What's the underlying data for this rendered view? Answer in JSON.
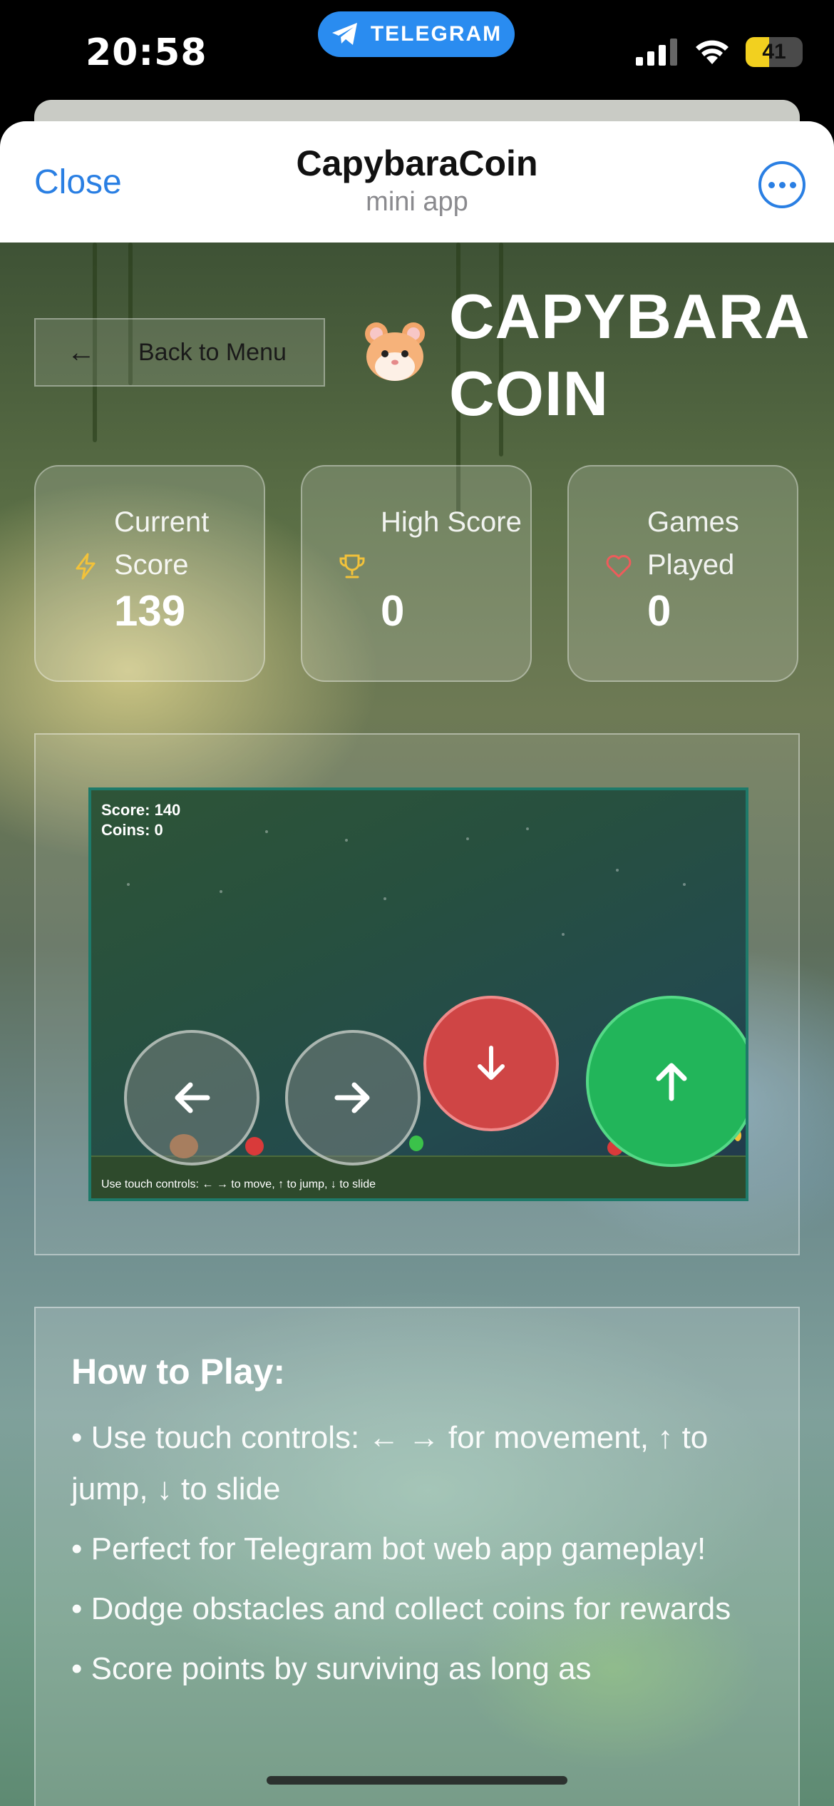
{
  "status_bar": {
    "time": "20:58",
    "pill_label": "TELEGRAM",
    "battery": "41",
    "battery_level": 0.41
  },
  "header": {
    "close_label": "Close",
    "title": "CapybaraCoin",
    "subtitle": "mini app"
  },
  "game_page": {
    "back_label": "Back to Menu",
    "brand_line1": "CAPYBARA",
    "brand_line2": "COIN",
    "stats": [
      {
        "label": "Current Score",
        "value": "139",
        "icon": "lightning-icon"
      },
      {
        "label": "High Score",
        "value": "0",
        "icon": "trophy-icon"
      },
      {
        "label": "Games Played",
        "value": "0",
        "icon": "heart-icon"
      }
    ],
    "canvas": {
      "score_text": "Score: 140",
      "coins_text": "Coins: 0",
      "hint": "Use touch controls: ← → to move, ↑ to jump, ↓ to slide"
    },
    "controls": {
      "left": "←",
      "right": "→",
      "down": "↓",
      "up": "↑"
    },
    "howto": {
      "title": "How to Play:",
      "items": [
        "• Use touch controls: ← → for movement, ↑ to jump, ↓ to slide",
        "• Perfect for Telegram bot web app gameplay!",
        "• Dodge obstacles and collect coins for rewards",
        "• Score points by surviving as long as"
      ]
    }
  },
  "colors": {
    "accent": "#2a7fe3",
    "telegram": "#2a8cf0",
    "jump": "#22b55a",
    "slide": "#cf4545"
  }
}
